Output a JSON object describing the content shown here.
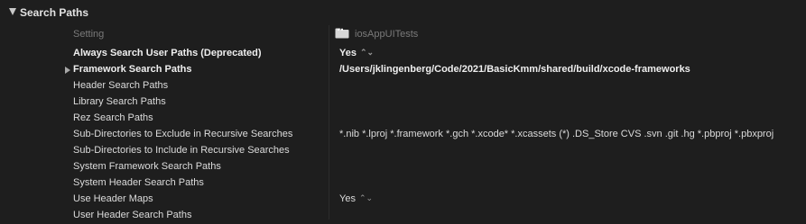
{
  "section": {
    "title": "Search Paths"
  },
  "columns": {
    "setting": "Setting",
    "target": "iosAppUITests"
  },
  "rows": [
    {
      "name": "Always Search User Paths (Deprecated)",
      "value": "Yes",
      "bold": true,
      "stepper": true
    },
    {
      "name": "Framework Search Paths",
      "value": "/Users/jklingenberg/Code/2021/BasicKmm/shared/build/xcode-frameworks",
      "bold": true,
      "expandable": true
    },
    {
      "name": "Header Search Paths",
      "value": ""
    },
    {
      "name": "Library Search Paths",
      "value": ""
    },
    {
      "name": "Rez Search Paths",
      "value": ""
    },
    {
      "name": "Sub-Directories to Exclude in Recursive Searches",
      "value": "*.nib *.lproj *.framework *.gch *.xcode* *.xcassets (*) .DS_Store CVS .svn .git .hg *.pbproj *.pbxproj"
    },
    {
      "name": "Sub-Directories to Include in Recursive Searches",
      "value": ""
    },
    {
      "name": "System Framework Search Paths",
      "value": ""
    },
    {
      "name": "System Header Search Paths",
      "value": ""
    },
    {
      "name": "Use Header Maps",
      "value": "Yes",
      "stepper": true
    },
    {
      "name": "User Header Search Paths",
      "value": ""
    }
  ],
  "icons": {
    "stepper": "⌃⌄",
    "target": "folder-icon"
  }
}
